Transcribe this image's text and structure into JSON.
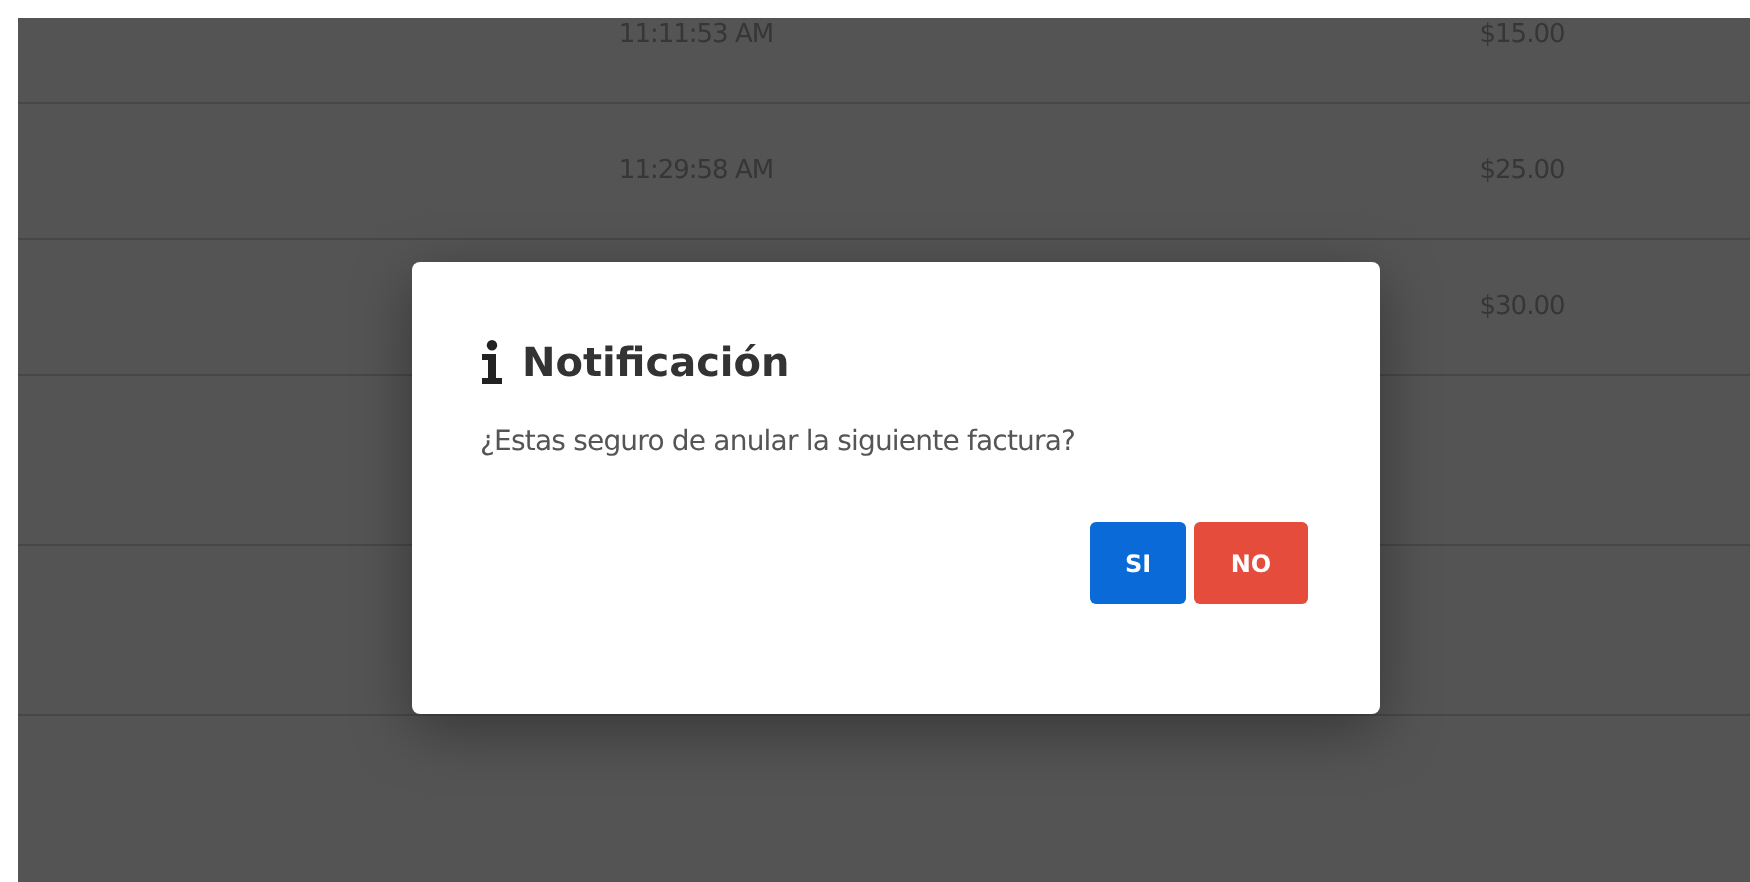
{
  "table": {
    "rows": [
      {
        "time": "11:11:53 AM",
        "amount": "$15.00"
      },
      {
        "time": "11:29:58 AM",
        "amount": "$25.00"
      },
      {
        "amount": "$30.00"
      }
    ]
  },
  "dialog": {
    "title": "Notificación",
    "message": "¿Estas seguro de anular la siguiente factura?",
    "buttons": [
      {
        "label": "SI",
        "kind": "confirm"
      },
      {
        "label": "NO",
        "kind": "cancel"
      }
    ]
  }
}
